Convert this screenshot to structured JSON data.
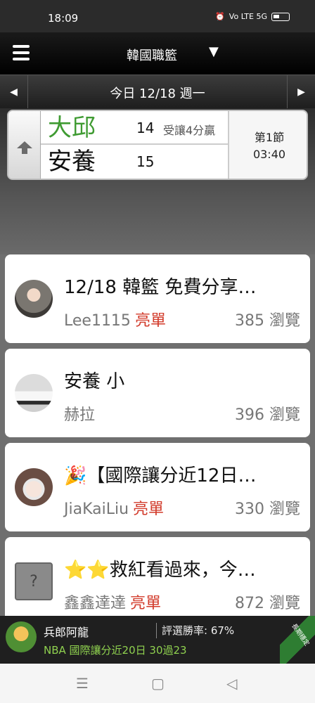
{
  "status_bar": {
    "time": "18:09",
    "network": "Vo LTE 5G"
  },
  "header": {
    "league": "韓國職籃"
  },
  "date_bar": {
    "label": "今日 12/18 週一"
  },
  "game": {
    "home": {
      "name": "大邱",
      "score": "14",
      "handicap": "受讓4分贏"
    },
    "away": {
      "name": "安養",
      "score": "15"
    },
    "period": "第1節",
    "clock": "03:40"
  },
  "posts": [
    {
      "title": "12/18 韓籃 免費分享…",
      "author": "Lee1115",
      "badge": "亮單",
      "views": "385 瀏覽"
    },
    {
      "title": "安養 小",
      "author": "赫拉",
      "badge": "",
      "views": "396 瀏覽"
    },
    {
      "title": "🎉【國際讓分近12日…",
      "author": "JiaKaiLiu",
      "badge": "亮單",
      "views": "330 瀏覽"
    },
    {
      "title": "⭐⭐救紅看過來，今…",
      "author": "鑫鑫達達",
      "badge": "亮單",
      "views": "872 瀏覽"
    }
  ],
  "banner": {
    "name": "兵郎阿龍",
    "rate": "評選勝率: 67%",
    "tagline": "NBA 國際讓分近20日 30過23",
    "ribbon": "長期穩定"
  },
  "icons": {
    "menu": "hamburger-icon",
    "dropdown": "triangle-down-icon",
    "prev": "triangle-left-icon",
    "next": "triangle-right-icon",
    "scroll_top": "arrow-up-icon"
  }
}
